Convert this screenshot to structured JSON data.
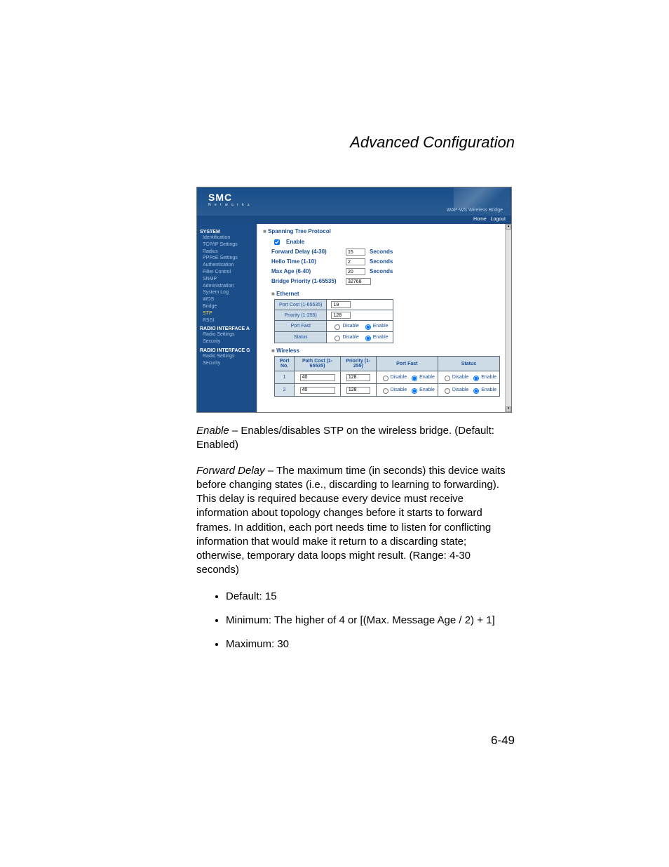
{
  "doc": {
    "title": "Advanced Configuration",
    "page_number": "6-49",
    "para1_term": "Enable",
    "para1_text": " – Enables/disables STP on the wireless bridge. (Default: Enabled)",
    "para2_term": "Forward Delay",
    "para2_text": " – The maximum time (in seconds) this device waits before changing states (i.e., discarding to learning to forwarding). This delay is required because every device must receive information about topology changes before it starts to forward frames. In addition, each port needs time to listen for conflicting information that would make it return to a discarding state; otherwise, temporary data loops might result. (Range: 4-30 seconds)",
    "bullets": [
      "Default: 15",
      "Minimum: The higher of 4 or [(Max. Message Age / 2) + 1]",
      "Maximum: 30"
    ]
  },
  "ui": {
    "logo": "SMC",
    "logo_sub": "N e t w o r k s",
    "head_right": "WAP-WS Wireless Bridge",
    "bar": {
      "home": "Home",
      "logout": "Logout"
    },
    "sidebar": {
      "g1": "SYSTEM",
      "items1": [
        "Identification",
        "TCP/IP Settings",
        "Radius",
        "PPPoE Settings",
        "Authentication",
        "Filter Control",
        "SNMP",
        "Administration",
        "System Log",
        "WDS",
        "Bridge",
        "STP",
        "RSSI"
      ],
      "g2": "RADIO INTERFACE A",
      "items2": [
        "Radio Settings",
        "Security"
      ],
      "g3": "RADIO INTERFACE G",
      "items3": [
        "Radio Settings",
        "Security"
      ]
    },
    "stp": {
      "section": "Spanning Tree Protocol",
      "enable_label": "Enable",
      "fd_label": "Forward Delay (4-30)",
      "fd_value": "15",
      "hello_label": "Hello Time (1-10)",
      "hello_value": "2",
      "max_label": "Max Age (6-40)",
      "max_value": "20",
      "prio_label": "Bridge Priority (1-65535)",
      "prio_value": "32768",
      "unit": "Seconds"
    },
    "eth": {
      "section": "Ethernet",
      "rows": [
        {
          "label": "Port Cost (1-65535)",
          "value": "19"
        },
        {
          "label": "Priority (1-255)",
          "value": "128"
        }
      ],
      "pf_label": "Port Fast",
      "st_label": "Status",
      "disable": "Disable",
      "enable": "Enable"
    },
    "wireless": {
      "section": "Wireless",
      "headers": [
        "Port No.",
        "Path Cost (1-65535)",
        "Priority (1-255)",
        "Port Fast",
        "Status"
      ],
      "rows": [
        {
          "no": "1",
          "cost": "40",
          "prio": "128"
        },
        {
          "no": "2",
          "cost": "40",
          "prio": "128"
        }
      ]
    }
  }
}
